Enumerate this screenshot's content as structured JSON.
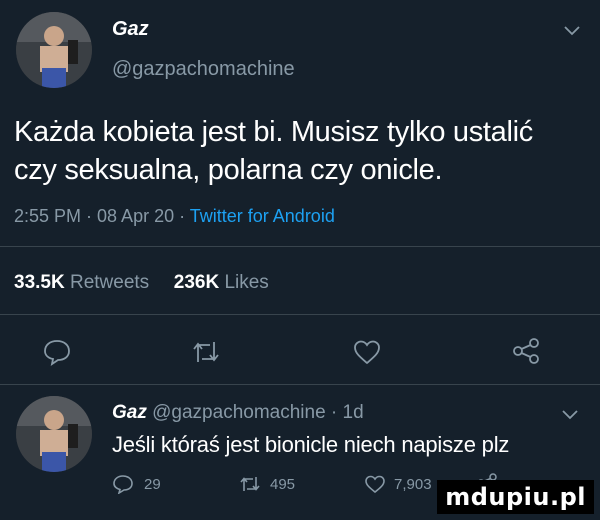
{
  "tweet": {
    "author_name": "Gaz",
    "handle": "@gazpachomachine",
    "text_line1": "Każda kobieta jest bi. Musisz tylko ustalić",
    "text_line2": "czy seksualna, polarna czy onicle.",
    "timestamp": "2:55 PM · 08 Apr 20 · ",
    "source": "Twitter for Android",
    "retweets_count": "33.5K",
    "retweets_label": "Retweets",
    "likes_count": "236K",
    "likes_label": "Likes"
  },
  "reply": {
    "author_name": "Gaz",
    "handle_time": "@gazpachomachine · 1d",
    "text": "Jeśli któraś jest bionicle niech napisze plz",
    "reply_count": "29",
    "retweet_count": "495",
    "like_count": "7,903"
  },
  "watermark": "mdupiu.pl",
  "colors": {
    "background": "#15202b",
    "muted": "#8899a6",
    "link": "#1da1f2",
    "divider": "#38444d"
  },
  "icons": [
    "chevron-down-icon",
    "reply-icon",
    "retweet-icon",
    "like-icon",
    "share-icon"
  ]
}
